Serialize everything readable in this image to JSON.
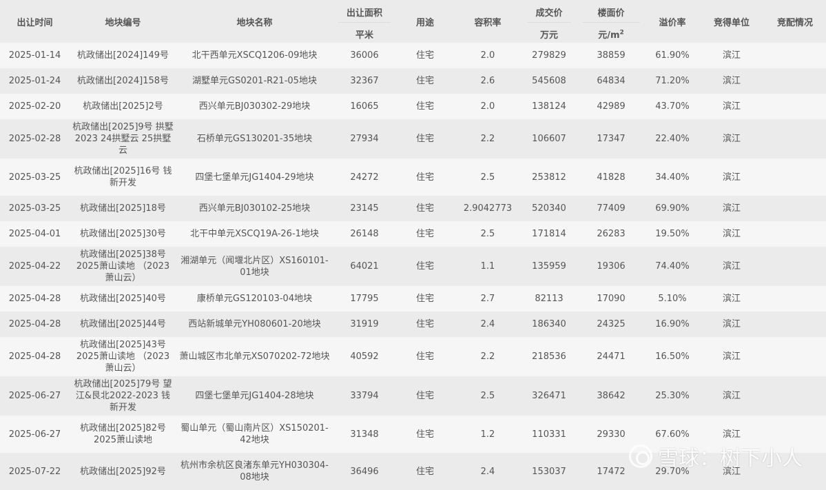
{
  "headers": {
    "date": "出让时间",
    "code": "地块编号",
    "name": "地块名称",
    "area": "出让面积",
    "area_unit": "平米",
    "usage": "用途",
    "far": "容积率",
    "price": "成交价",
    "price_unit": "万元",
    "floor_price": "楼面价",
    "floor_price_unit": "元/m",
    "floor_price_unit_sup": "2",
    "premium": "溢价率",
    "winner": "竞得单位",
    "allocation": "竞配情况"
  },
  "rows": [
    {
      "date": "2025-01-14",
      "code": "杭政储出[2024]149号",
      "name": "北干西单元XSCQ1206-09地块",
      "area": "36006",
      "usage": "住宅",
      "far": "2.0",
      "price": "279829",
      "floor_price": "38859",
      "premium": "61.90%",
      "winner": "滨江",
      "allocation": ""
    },
    {
      "date": "2025-01-24",
      "code": "杭政储出[2024]158号",
      "name": "湖墅单元GS0201-R21-05地块",
      "area": "32367",
      "usage": "住宅",
      "far": "2.6",
      "price": "545608",
      "floor_price": "64834",
      "premium": "71.20%",
      "winner": "滨江",
      "allocation": ""
    },
    {
      "date": "2025-02-20",
      "code": "杭政储出[2025]2号",
      "name": "西兴单元BJ030302-29地块",
      "area": "16065",
      "usage": "住宅",
      "far": "2.0",
      "price": "138124",
      "floor_price": "42989",
      "premium": "43.70%",
      "winner": "滨江",
      "allocation": ""
    },
    {
      "date": "2025-02-28",
      "code": "杭政储出[2025]9号 拱墅2023 24拱墅云 25拱墅云",
      "name": "石桥单元GS130201-35地块",
      "area": "27934",
      "usage": "住宅",
      "far": "2.2",
      "price": "106607",
      "floor_price": "17347",
      "premium": "22.40%",
      "winner": "滨江",
      "allocation": ""
    },
    {
      "date": "2025-03-25",
      "code": "杭政储出[2025]16号 钱新开发",
      "name": "四堡七堡单元JG1404-29地块",
      "area": "24272",
      "usage": "住宅",
      "far": "2.5",
      "price": "253812",
      "floor_price": "41828",
      "premium": "34.40%",
      "winner": "滨江",
      "allocation": ""
    },
    {
      "date": "2025-03-25",
      "code": "杭政储出[2025]18号",
      "name": "西兴单元BJ030102-25地块",
      "area": "23145",
      "usage": "住宅",
      "far": "2.9042773",
      "price": "520340",
      "floor_price": "77409",
      "premium": "69.90%",
      "winner": "滨江",
      "allocation": ""
    },
    {
      "date": "2025-04-01",
      "code": "杭政储出[2025]30号",
      "name": "北干中单元XSCQ19A-26-1地块",
      "area": "26148",
      "usage": "住宅",
      "far": "2.5",
      "price": "171814",
      "floor_price": "26283",
      "premium": "19.50%",
      "winner": "滨江",
      "allocation": ""
    },
    {
      "date": "2025-04-22",
      "code": "杭政储出[2025]38号 2025萧山读地 （2023萧山云）",
      "name": "湘湖单元（闻堰北片区）XS160101-01地块",
      "area": "64021",
      "usage": "住宅",
      "far": "1.1",
      "price": "135959",
      "floor_price": "19306",
      "premium": "74.40%",
      "winner": "滨江",
      "allocation": ""
    },
    {
      "date": "2025-04-28",
      "code": "杭政储出[2025]40号",
      "name": "康桥单元GS120103-04地块",
      "area": "17795",
      "usage": "住宅",
      "far": "2.7",
      "price": "82113",
      "floor_price": "17090",
      "premium": "5.10%",
      "winner": "滨江",
      "allocation": ""
    },
    {
      "date": "2025-04-28",
      "code": "杭政储出[2025]44号",
      "name": "西站新城单元YH080601-20地块",
      "area": "31919",
      "usage": "住宅",
      "far": "2.4",
      "price": "186340",
      "floor_price": "24325",
      "premium": "16.90%",
      "winner": "滨江",
      "allocation": ""
    },
    {
      "date": "2025-04-28",
      "code": "杭政储出[2025]43号 2025萧山读地 （2023萧山云）",
      "name": "萧山城区市北单元XS070202-72地块",
      "area": "40592",
      "usage": "住宅",
      "far": "2.2",
      "price": "218536",
      "floor_price": "24471",
      "premium": "16.50%",
      "winner": "滨江",
      "allocation": ""
    },
    {
      "date": "2025-06-27",
      "code": "杭政储出[2025]79号 望江&艮北2022-2023 钱新开发",
      "name": "四堡七堡单元JG1404-28地块",
      "area": "33794",
      "usage": "住宅",
      "far": "2.5",
      "price": "326471",
      "floor_price": "38642",
      "premium": "25.30%",
      "winner": "滨江",
      "allocation": ""
    },
    {
      "date": "2025-06-27",
      "code": "杭政储出[2025]82号 2025萧山读地",
      "name": "蜀山单元（蜀山南片区）XS150201-42地块",
      "area": "31348",
      "usage": "住宅",
      "far": "1.2",
      "price": "110331",
      "floor_price": "29330",
      "premium": "67.60%",
      "winner": "滨江",
      "allocation": ""
    },
    {
      "date": "2025-07-22",
      "code": "杭政储出[2025]92号",
      "name": "杭州市余杭区良渚东单元YH030304-08地块",
      "area": "36496",
      "usage": "住宅",
      "far": "2.4",
      "price": "153037",
      "floor_price": "17472",
      "premium": "29.70%",
      "winner": "滨江",
      "allocation": ""
    }
  ],
  "watermark": "雪球：树下小人"
}
